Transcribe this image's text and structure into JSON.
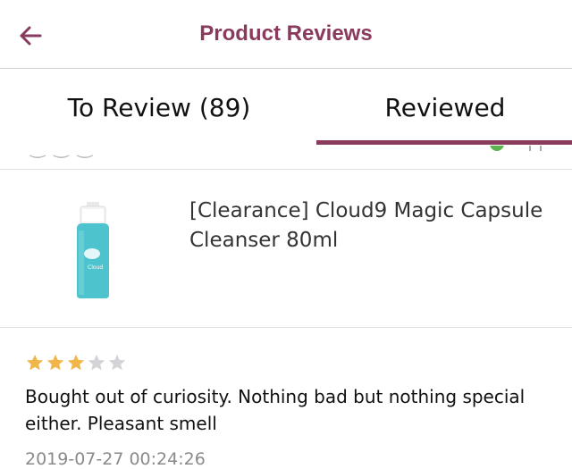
{
  "header": {
    "title": "Product Reviews",
    "back_icon": "arrow-left-icon",
    "accent_color": "#8a3a5c"
  },
  "tabs": [
    {
      "label": "To Review (89)",
      "active": false
    },
    {
      "label": "Reviewed",
      "active": true
    }
  ],
  "product": {
    "name": "[Clearance] Cloud9 Magic Capsule Cleanser 80ml",
    "image_icon": "product-bottle-image"
  },
  "review": {
    "rating": 3,
    "max_rating": 5,
    "text": "Bought out of curiosity. Nothing bad but nothing special either. Pleasant smell",
    "date": "2019-07-27 00:24:26"
  }
}
